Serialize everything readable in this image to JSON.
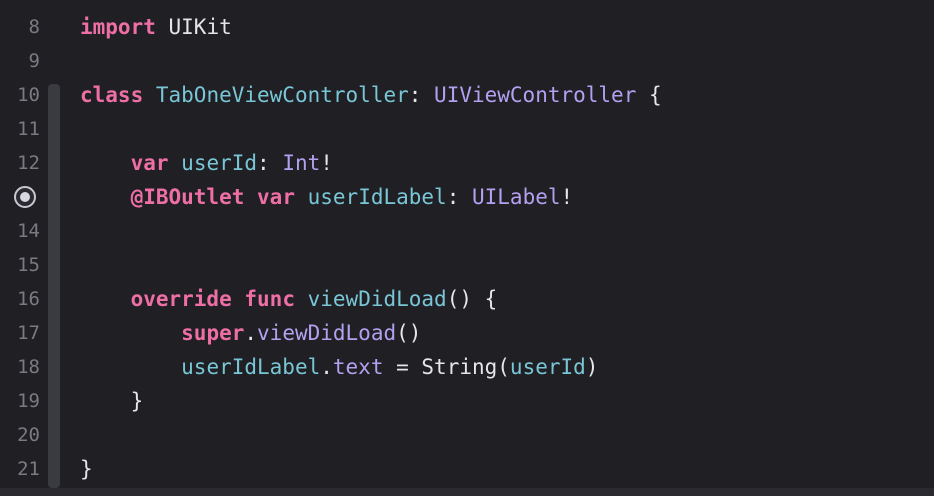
{
  "editor": {
    "lines": [
      {
        "num": "8",
        "tokens": [
          {
            "t": "import",
            "c": "kw"
          },
          {
            "t": " ",
            "c": "pl"
          },
          {
            "t": "UIKit",
            "c": "pl"
          }
        ]
      },
      {
        "num": "9",
        "tokens": []
      },
      {
        "num": "10",
        "tokens": [
          {
            "t": "class",
            "c": "kw"
          },
          {
            "t": " ",
            "c": "pl"
          },
          {
            "t": "TabOneViewController",
            "c": "id"
          },
          {
            "t": ": ",
            "c": "pl"
          },
          {
            "t": "UIViewController",
            "c": "ty"
          },
          {
            "t": " {",
            "c": "pl"
          }
        ]
      },
      {
        "num": "11",
        "tokens": []
      },
      {
        "num": "12",
        "tokens": [
          {
            "t": "    ",
            "c": "pl"
          },
          {
            "t": "var",
            "c": "kw"
          },
          {
            "t": " ",
            "c": "pl"
          },
          {
            "t": "userId",
            "c": "id"
          },
          {
            "t": ": ",
            "c": "pl"
          },
          {
            "t": "Int",
            "c": "ty"
          },
          {
            "t": "!",
            "c": "pl"
          }
        ]
      },
      {
        "num": "13",
        "tokens": [
          {
            "t": "    ",
            "c": "pl"
          },
          {
            "t": "@IBOutlet",
            "c": "kw"
          },
          {
            "t": " ",
            "c": "pl"
          },
          {
            "t": "var",
            "c": "kw"
          },
          {
            "t": " ",
            "c": "pl"
          },
          {
            "t": "userIdLabel",
            "c": "id"
          },
          {
            "t": ": ",
            "c": "pl"
          },
          {
            "t": "UILabel",
            "c": "ty"
          },
          {
            "t": "!",
            "c": "pl"
          }
        ]
      },
      {
        "num": "14",
        "tokens": []
      },
      {
        "num": "15",
        "tokens": []
      },
      {
        "num": "16",
        "tokens": [
          {
            "t": "    ",
            "c": "pl"
          },
          {
            "t": "override",
            "c": "kw"
          },
          {
            "t": " ",
            "c": "pl"
          },
          {
            "t": "func",
            "c": "kw"
          },
          {
            "t": " ",
            "c": "pl"
          },
          {
            "t": "viewDidLoad",
            "c": "id"
          },
          {
            "t": "() {",
            "c": "pl"
          }
        ]
      },
      {
        "num": "17",
        "tokens": [
          {
            "t": "        ",
            "c": "pl"
          },
          {
            "t": "super",
            "c": "kw"
          },
          {
            "t": ".",
            "c": "pl"
          },
          {
            "t": "viewDidLoad",
            "c": "ty"
          },
          {
            "t": "()",
            "c": "pl"
          }
        ]
      },
      {
        "num": "18",
        "tokens": [
          {
            "t": "        ",
            "c": "pl"
          },
          {
            "t": "userIdLabel",
            "c": "id"
          },
          {
            "t": ".",
            "c": "pl"
          },
          {
            "t": "text",
            "c": "ty"
          },
          {
            "t": " = ",
            "c": "pl"
          },
          {
            "t": "String",
            "c": "pl"
          },
          {
            "t": "(",
            "c": "pl"
          },
          {
            "t": "userId",
            "c": "id"
          },
          {
            "t": ")",
            "c": "pl"
          }
        ]
      },
      {
        "num": "19",
        "tokens": [
          {
            "t": "    ",
            "c": "pl"
          },
          {
            "t": "}",
            "c": "pl"
          }
        ]
      },
      {
        "num": "20",
        "tokens": []
      },
      {
        "num": "21",
        "tokens": [
          {
            "t": "}",
            "c": "pl"
          }
        ]
      }
    ],
    "outlet_line": "13",
    "colors": {
      "background": "#1f1f24",
      "keyword": "#ee6fa6",
      "type": "#b4a0f0",
      "identifier": "#79c6d6",
      "plain": "#e6e6e8",
      "line_number": "#7a7a80"
    },
    "icons": {
      "outlet": "outlet-connected-icon"
    }
  }
}
